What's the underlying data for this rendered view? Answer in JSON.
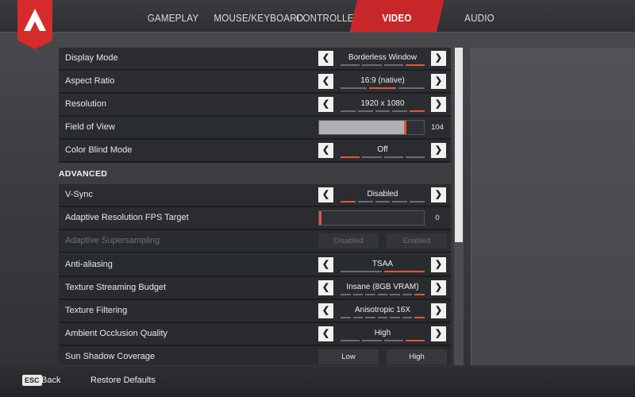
{
  "tabs": [
    {
      "label": "GAMEPLAY",
      "active": false
    },
    {
      "label": "MOUSE/KEYBOARD",
      "active": false
    },
    {
      "label": "CONTROLLER",
      "active": false
    },
    {
      "label": "VIDEO",
      "active": true
    },
    {
      "label": "AUDIO",
      "active": false
    }
  ],
  "colors": {
    "accent": "#c8272a",
    "indicator": "#e4563a",
    "row_bg": "#2a2c30"
  },
  "settings": {
    "display_mode": {
      "label": "Display Mode",
      "value": "Borderless Window",
      "options": 4,
      "selected": 3
    },
    "aspect_ratio": {
      "label": "Aspect Ratio",
      "value": "16:9 (native)",
      "options": 3,
      "selected": 2
    },
    "resolution": {
      "label": "Resolution",
      "value": "1920 x 1080",
      "options": 5,
      "selected": 5
    },
    "field_of_view": {
      "label": "Field of View",
      "value": "104",
      "level": 0.82
    },
    "color_blind_mode": {
      "label": "Color Blind Mode",
      "value": "Off",
      "options": 4,
      "selected": 1
    },
    "advanced_header": "ADVANCED",
    "v_sync": {
      "label": "V-Sync",
      "value": "Disabled",
      "options": 5,
      "selected": 1
    },
    "adaptive_fps": {
      "label": "Adaptive Resolution FPS Target",
      "value": "0",
      "level": 0.0
    },
    "adaptive_supersampling": {
      "label": "Adaptive Supersampling",
      "option_a": "Disabled",
      "option_b": "Enabled"
    },
    "anti_aliasing": {
      "label": "Anti-aliasing",
      "value": "TSAA",
      "options": 2,
      "selected": 2
    },
    "texture_budget": {
      "label": "Texture Streaming Budget",
      "value": "Insane (8GB VRAM)",
      "options": 7,
      "selected": 7
    },
    "texture_filtering": {
      "label": "Texture Filtering",
      "value": "Anisotropic 16X",
      "options": 7,
      "selected": 7
    },
    "ambient_occlusion": {
      "label": "Ambient Occlusion Quality",
      "value": "High",
      "options": 4,
      "selected": 4
    },
    "sun_shadow": {
      "label": "Sun Shadow Coverage",
      "option_a": "Low",
      "option_b": "High"
    }
  },
  "footer": {
    "esc_key": "ESC",
    "back_label": "Back",
    "restore_label": "Restore Defaults"
  }
}
